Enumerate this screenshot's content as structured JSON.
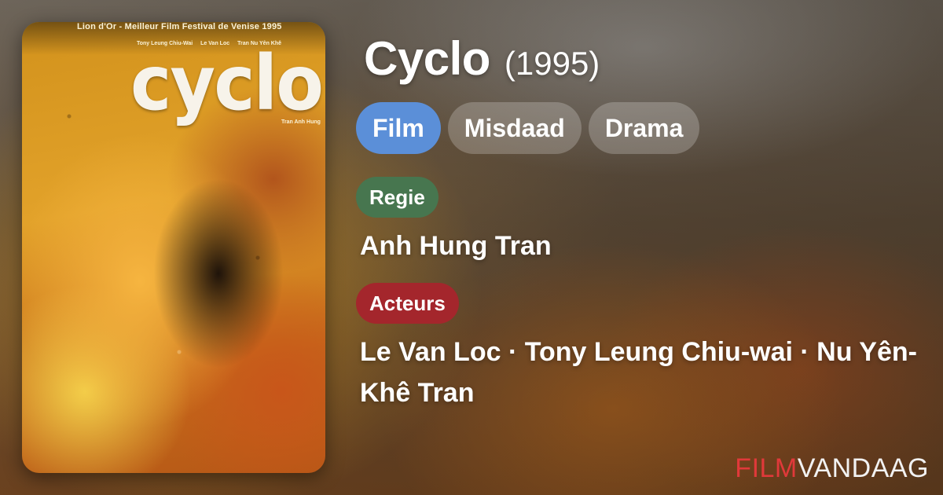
{
  "poster": {
    "alt": "Cyclo poster",
    "tagline": "Lion d'Or - Meilleur Film Festival de Venise 1995",
    "cast_line": [
      "Tony Leung Chiu-Wai",
      "Le Van Loc",
      "Tran Nu Yên Khê"
    ],
    "logo_text": "cyclo",
    "credit": "Tran Anh Hung"
  },
  "movie": {
    "title": "Cyclo",
    "year": "(1995)"
  },
  "genres": [
    "Film",
    "Misdaad",
    "Drama"
  ],
  "director": {
    "label": "Regie",
    "name": "Anh Hung Tran"
  },
  "actors": {
    "label": "Acteurs",
    "names": "Le Van Loc · Tony Leung Chiu-wai · Nu Yên-Khê Tran"
  },
  "brand": {
    "part1": "FILM",
    "part2": "VANDAAG"
  },
  "colors": {
    "genre_primary": "#5b8fd8",
    "regie_label": "#47764f",
    "acteurs_label": "#a4262c",
    "brand_red": "#e0393a"
  }
}
